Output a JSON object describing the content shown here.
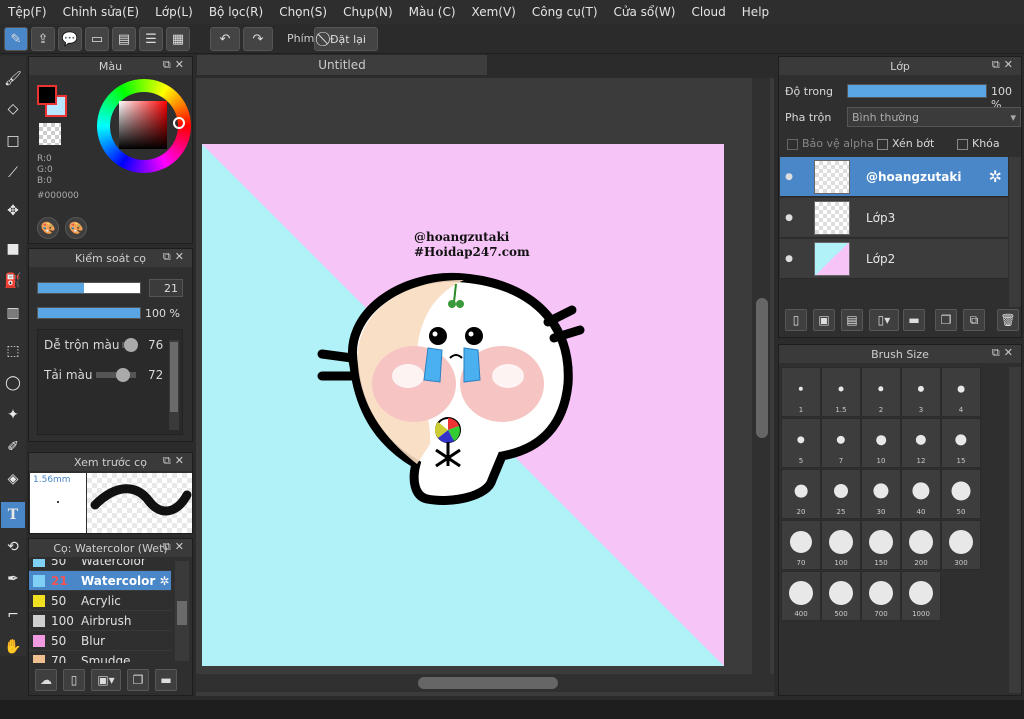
{
  "menu": [
    "Tệp(F)",
    "Chỉnh sửa(E)",
    "Lớp(L)",
    "Bộ lọc(R)",
    "Chọn(S)",
    "Chụp(N)",
    "Màu (C)",
    "Xem(V)",
    "Công cụ(T)",
    "Cửa sổ(W)",
    "Cloud",
    "Help"
  ],
  "toolbar": {
    "snap_label": "Phím",
    "reset_label": "Đặt lại"
  },
  "color_panel": {
    "title": "Màu",
    "r": "R:0",
    "g": "G:0",
    "b": "B:0",
    "hex": "#000000",
    "fg_color": "#000000",
    "bg_color": "#b8e6ff"
  },
  "brush_control": {
    "title": "Kiểm soát cọ",
    "size_value": "21",
    "opacity_value": "100 %",
    "size_fraction": 0.45,
    "opacity_fraction": 1.0,
    "mix_label": "Dễ trộn màu",
    "mix_value": "76",
    "amount_label": "Tải màu",
    "amount_value": "72"
  },
  "preview": {
    "title": "Xem trước cọ",
    "size_label": "1.56mm"
  },
  "brush_list": {
    "title": "Cọ: Watercolor (Wet)",
    "items": [
      {
        "size": "50",
        "name": "Watercolor",
        "color": "#7fd0f5",
        "selected": false
      },
      {
        "size": "21",
        "name": "Watercolor",
        "color": "#7fd0f5",
        "selected": true
      },
      {
        "size": "50",
        "name": "Acrylic",
        "color": "#f0e020",
        "selected": false
      },
      {
        "size": "100",
        "name": "Airbrush",
        "color": "#cfcfcf",
        "selected": false
      },
      {
        "size": "50",
        "name": "Blur",
        "color": "#f09ae0",
        "selected": false
      },
      {
        "size": "70",
        "name": "Smudge",
        "color": "#f0c090",
        "selected": false
      }
    ]
  },
  "document": {
    "tab_title": "Untitled"
  },
  "artwork": {
    "credit_line1": "@hoangzutaki",
    "credit_line2": "#Hoidap247.com",
    "pink": "#f7c4f7",
    "cyan": "#b1f1f8"
  },
  "layer_panel": {
    "title": "Lớp",
    "opacity_label": "Độ trong",
    "opacity_value": "100 %",
    "blend_label": "Pha trộn",
    "blend_value": "Bình thường",
    "protect_alpha": "Bảo vệ alpha",
    "clipping": "Xén bớt",
    "lock": "Khóa",
    "layers": [
      {
        "name": "@hoangzutaki",
        "selected": true
      },
      {
        "name": "Lớp3",
        "selected": false
      },
      {
        "name": "Lớp2",
        "selected": false
      }
    ]
  },
  "brush_size_panel": {
    "title": "Brush Size",
    "sizes": [
      "1",
      "1.5",
      "2",
      "3",
      "4",
      "5",
      "7",
      "10",
      "12",
      "15",
      "20",
      "25",
      "30",
      "40",
      "50",
      "70",
      "100",
      "150",
      "200",
      "300",
      "400",
      "500",
      "700",
      "1000"
    ]
  }
}
